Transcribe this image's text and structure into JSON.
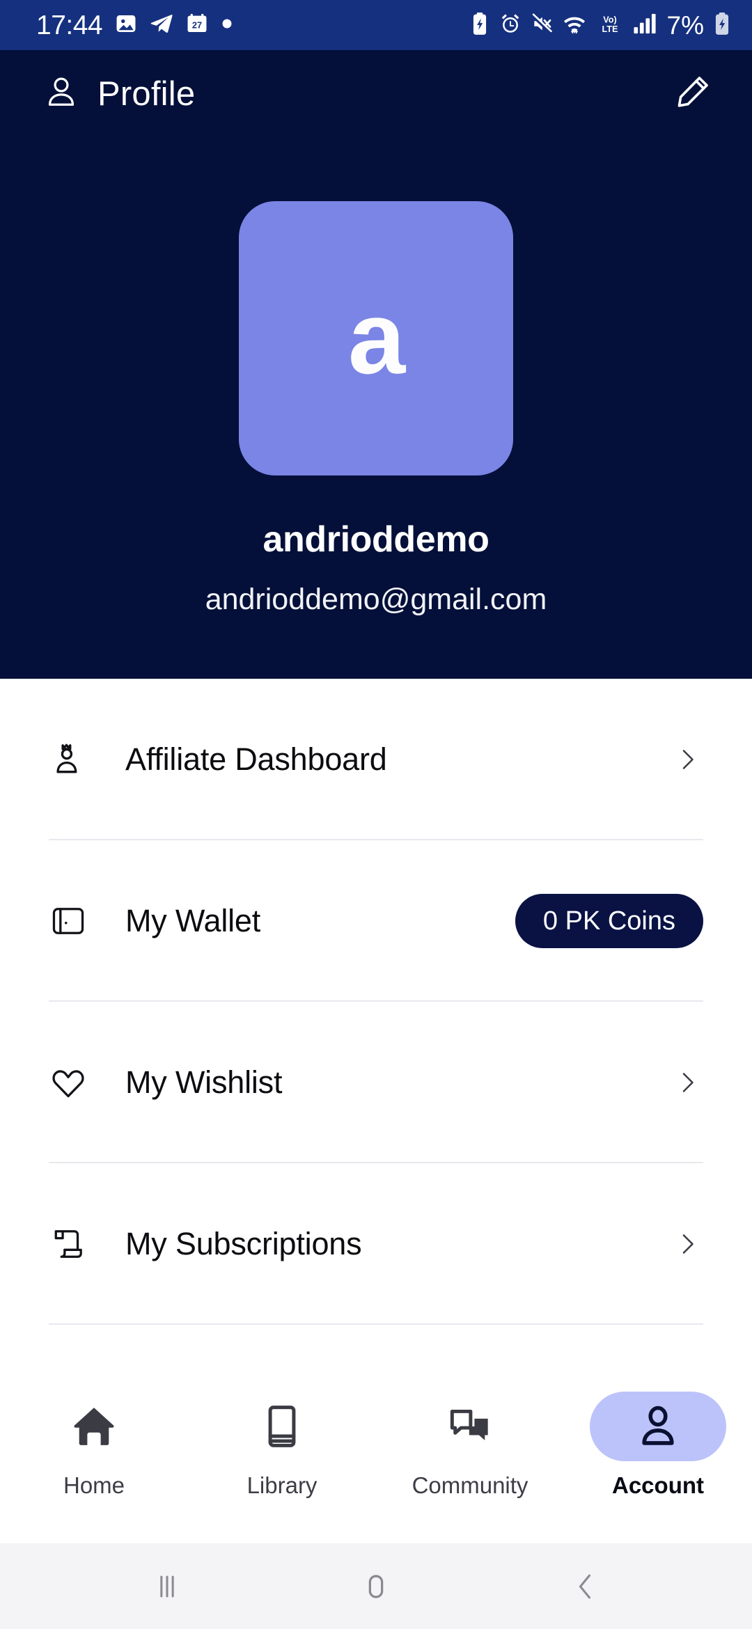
{
  "statusbar": {
    "time": "17:44",
    "battery_percent": "7%",
    "left_icons": [
      "gallery-icon",
      "telegram-icon",
      "calendar-icon",
      "dot-icon"
    ],
    "right_icons": [
      "battery-saver-icon",
      "alarm-icon",
      "mute-icon",
      "wifi-icon",
      "volte-icon",
      "signal-icon"
    ],
    "volte_label_top": "Vo)",
    "volte_label_bottom": "LTE",
    "background": "#15307e"
  },
  "header": {
    "title": "Profile",
    "profile_icon": "person-icon",
    "edit_icon": "pencil-icon",
    "avatar_letter": "a",
    "avatar_color": "#7b85e5",
    "user_name": "andrioddemo",
    "user_email": "andrioddemo@gmail.com",
    "background": "#041039"
  },
  "menu": {
    "items": [
      {
        "label": "Affiliate Dashboard",
        "icon": "affiliate-user-icon",
        "trailing": "chevron"
      },
      {
        "label": "My Wallet",
        "icon": "wallet-icon",
        "trailing": "badge",
        "badge": "0 PK Coins",
        "badge_color": "#0a1244"
      },
      {
        "label": "My Wishlist",
        "icon": "heart-icon",
        "trailing": "chevron"
      },
      {
        "label": "My Subscriptions",
        "icon": "subscription-scroll-icon",
        "trailing": "chevron"
      }
    ]
  },
  "bottomnav": {
    "active_color": "#bcc3fa",
    "items": [
      {
        "label": "Home",
        "icon": "home-icon",
        "active": false
      },
      {
        "label": "Library",
        "icon": "library-book-icon",
        "active": false
      },
      {
        "label": "Community",
        "icon": "chat-bubbles-icon",
        "active": false
      },
      {
        "label": "Account",
        "icon": "account-person-icon",
        "active": true
      }
    ]
  },
  "sysnav": {
    "recents_icon": "recents-icon",
    "home_icon": "home-square-icon",
    "back_icon": "back-chevron-icon",
    "background": "#f4f4f6"
  }
}
